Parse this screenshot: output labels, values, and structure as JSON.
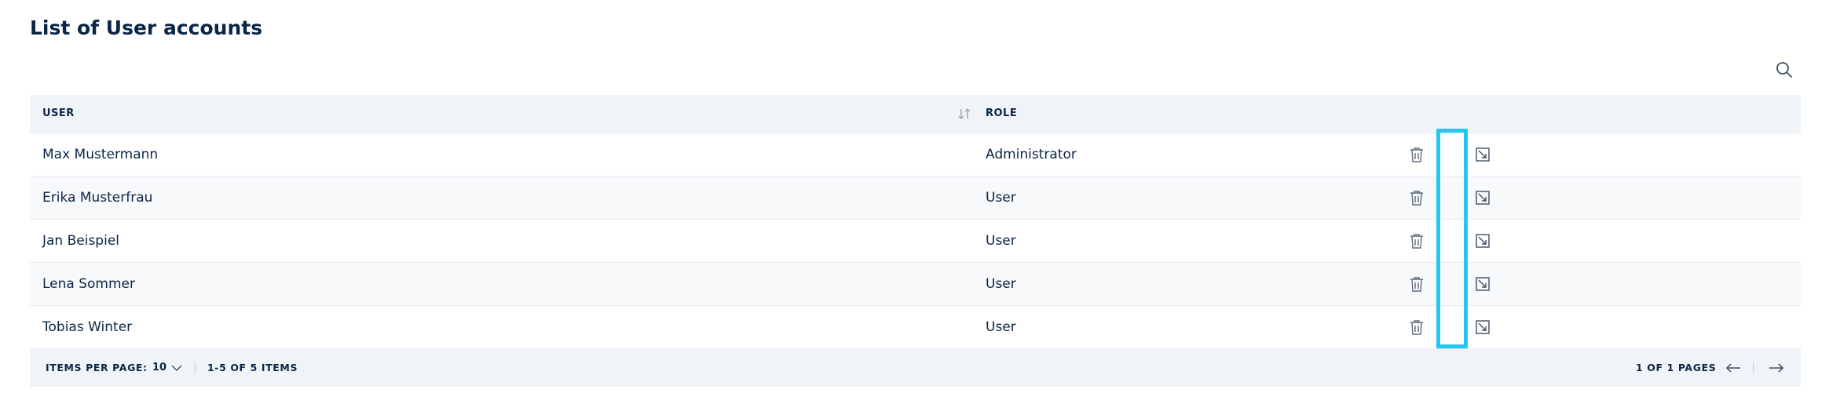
{
  "page": {
    "title": "List of User accounts"
  },
  "table": {
    "columns": {
      "user": "USER",
      "role": "ROLE"
    },
    "rows": [
      {
        "user": "Max Mustermann",
        "role": "Administrator"
      },
      {
        "user": "Erika Musterfrau",
        "role": "User"
      },
      {
        "user": "Jan Beispiel",
        "role": "User"
      },
      {
        "user": "Lena Sommer",
        "role": "User"
      },
      {
        "user": "Tobias Winter",
        "role": "User"
      }
    ]
  },
  "pagination": {
    "items_per_page_label": "ITEMS PER PAGE:",
    "items_per_page_value": "10",
    "range_text": "1-5 OF 5 ITEMS",
    "pages_text": "1 OF 1 PAGES"
  },
  "icons": {
    "search": "search-icon",
    "sort": "sort-icon",
    "delete": "trash-icon",
    "edit": "edit-icon",
    "dropdown": "chevron-down-icon",
    "prev": "arrow-left-icon",
    "next": "arrow-right-icon"
  },
  "colors": {
    "text": "#0b2545",
    "header_bg": "#f0f4f8",
    "highlight": "#22c8ef",
    "icon": "#5b6b7c"
  }
}
